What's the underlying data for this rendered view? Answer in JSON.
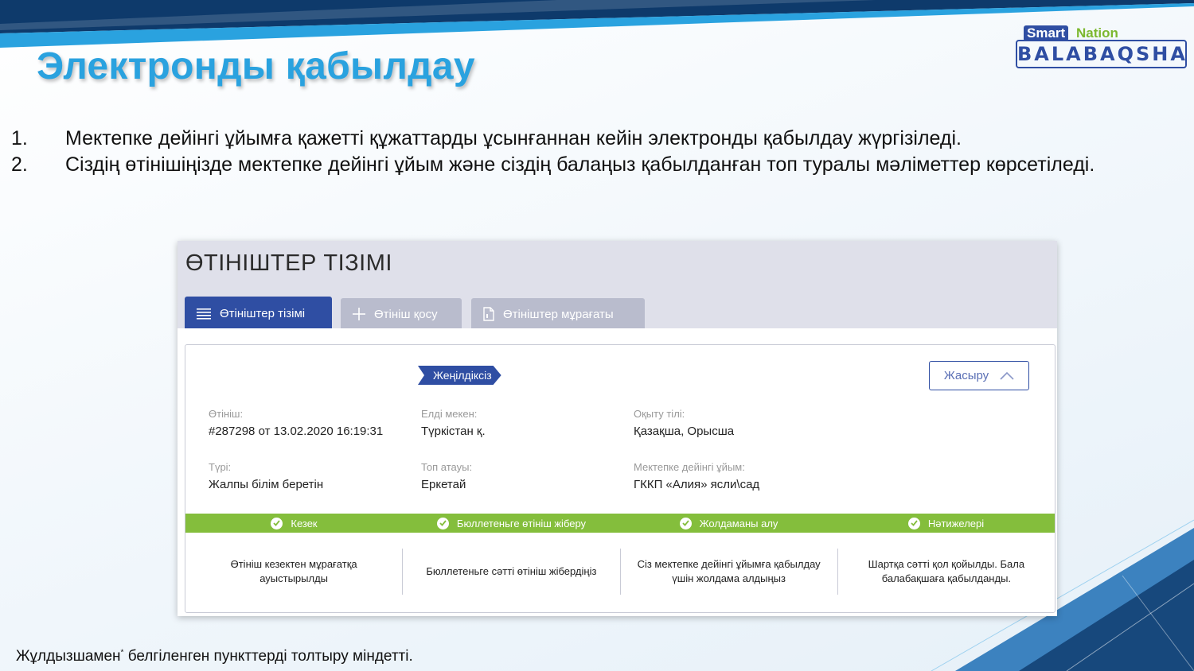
{
  "slide": {
    "title": "Электронды қабылдау",
    "points": [
      {
        "num": "1.",
        "text": "Мектепке дейінгі ұйымға қажетті құжаттарды ұсынғаннан кейін электронды қабылдау жүргізіледі."
      },
      {
        "num": "2.",
        "text": "Сіздің өтінішіңізде мектепке дейінгі ұйым және сіздің балаңыз қабылданған топ туралы мәліметтер көрсетіледі."
      }
    ],
    "footnote_main": "Жұлдызшамен",
    "footnote_star": "*",
    "footnote_rest": " белгіленген пункттерді толтыру міндетті."
  },
  "logo": {
    "smart": "Smart",
    "nation": "Nation",
    "brand": "BALABAQSHA"
  },
  "colors": {
    "accent": "#2f4ea3",
    "title": "#2aa2df",
    "success": "#84be3c"
  },
  "app": {
    "title": "ӨТІНІШТЕР ТІЗІМІ",
    "tabs": [
      {
        "label": "Өтініштер тізімі",
        "icon": "list-icon"
      },
      {
        "label": "Өтініш қосу",
        "icon": "plus-icon"
      },
      {
        "label": "Өтініштер мұрағаты",
        "icon": "document-icon"
      }
    ],
    "card": {
      "badge": "Жеңілдіксіз",
      "hide_label": "Жасыру",
      "fields": {
        "application": {
          "label": "Өтініш:",
          "value": "#287298 от 13.02.2020 16:19:31"
        },
        "locality": {
          "label": "Елді мекен:",
          "value": "Түркістан қ."
        },
        "language": {
          "label": "Оқыту тілі:",
          "value": "Қазақша, Орысша"
        },
        "type": {
          "label": "Түрі:",
          "value": "Жалпы білім беретін"
        },
        "group": {
          "label": "Топ атауы:",
          "value": "Еркетай"
        },
        "organization": {
          "label": "Мектепке дейінгі ұйым:",
          "value": "ГККП «Алия» ясли\\сад"
        }
      },
      "stages": [
        {
          "label": "Кезек",
          "description": "Өтініш кезектен мұрағатқа ауыстырылды"
        },
        {
          "label": "Бюллетеньге өтініш жіберу",
          "description": "Бюллетеньге сәтті өтініш жібердіңіз"
        },
        {
          "label": "Жолдаманы алу",
          "description": "Сіз мектепке дейінгі ұйымға қабылдау үшін жолдама алдыңыз"
        },
        {
          "label": "Нәтижелері",
          "description": "Шартқа сәтті қол қойылды. Бала балабақшаға қабылданды."
        }
      ]
    }
  }
}
